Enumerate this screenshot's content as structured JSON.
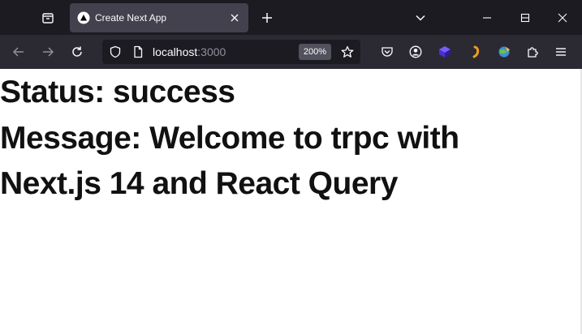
{
  "browser": {
    "tab": {
      "title": "Create Next App"
    },
    "url": {
      "host": "localhost",
      "port": ":3000"
    },
    "zoom": "200%",
    "colors": {
      "tabstrip": "#1c1b22",
      "toolbar": "#2b2a33",
      "active_tab": "#42414d",
      "urlbar": "#1c1b22"
    }
  },
  "page": {
    "status_line": "Status: success",
    "message_line_1": "Message: Welcome to trpc with",
    "message_line_2": "Next.js 14 and React Query"
  }
}
